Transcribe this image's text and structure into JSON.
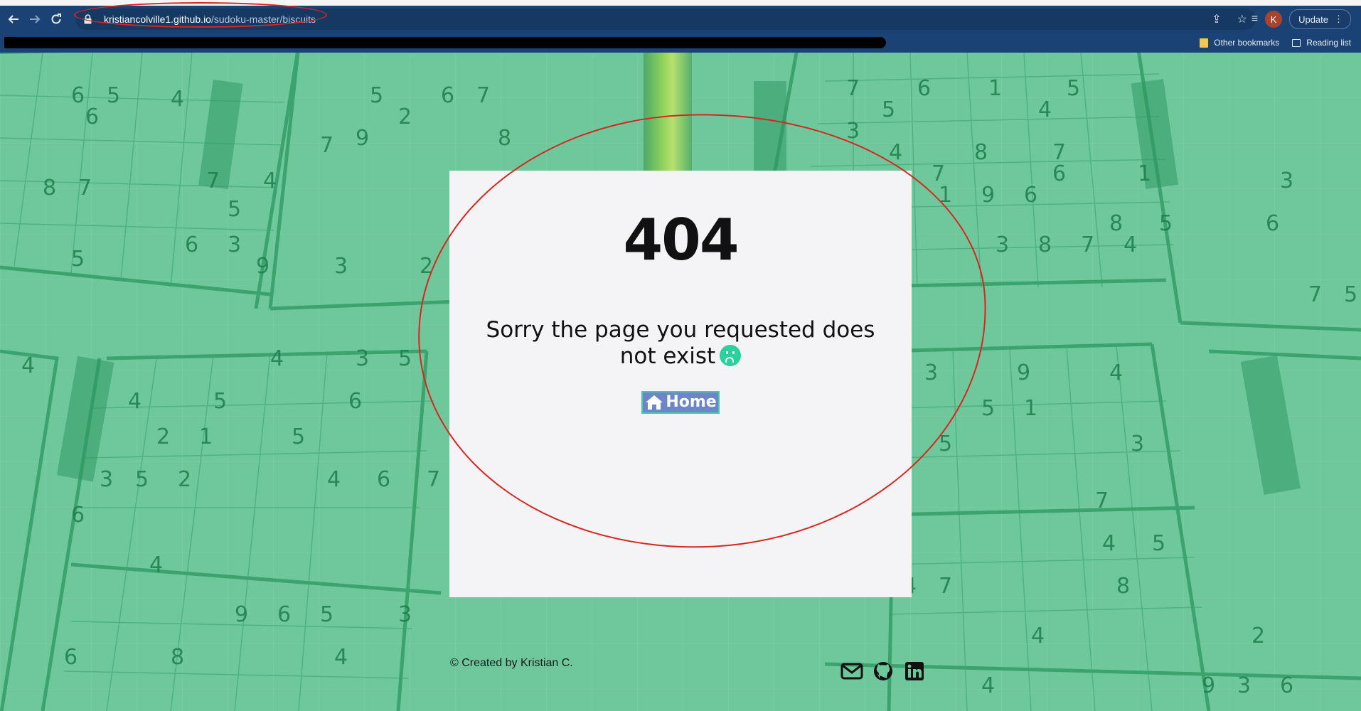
{
  "browser": {
    "url_host": "kristiancolville1.github.io",
    "url_path": "/sudoku-master/biscuits",
    "avatar_initial": "K",
    "update_label": "Update",
    "bookmarks": {
      "other": "Other bookmarks",
      "reading": "Reading list"
    }
  },
  "page": {
    "error_code": "404",
    "message": "Sorry the page you requested does not exist",
    "home_label": "Home",
    "footer": "© Created by Kristian C.",
    "socials": [
      "envelope-icon",
      "github-icon",
      "linkedin-icon"
    ]
  },
  "colors": {
    "chrome": "#1b4275",
    "page_tint": "#6fc89c",
    "card": "#f4f4f7",
    "home_button": "#6d86c7",
    "annotation": "#d7261f"
  }
}
